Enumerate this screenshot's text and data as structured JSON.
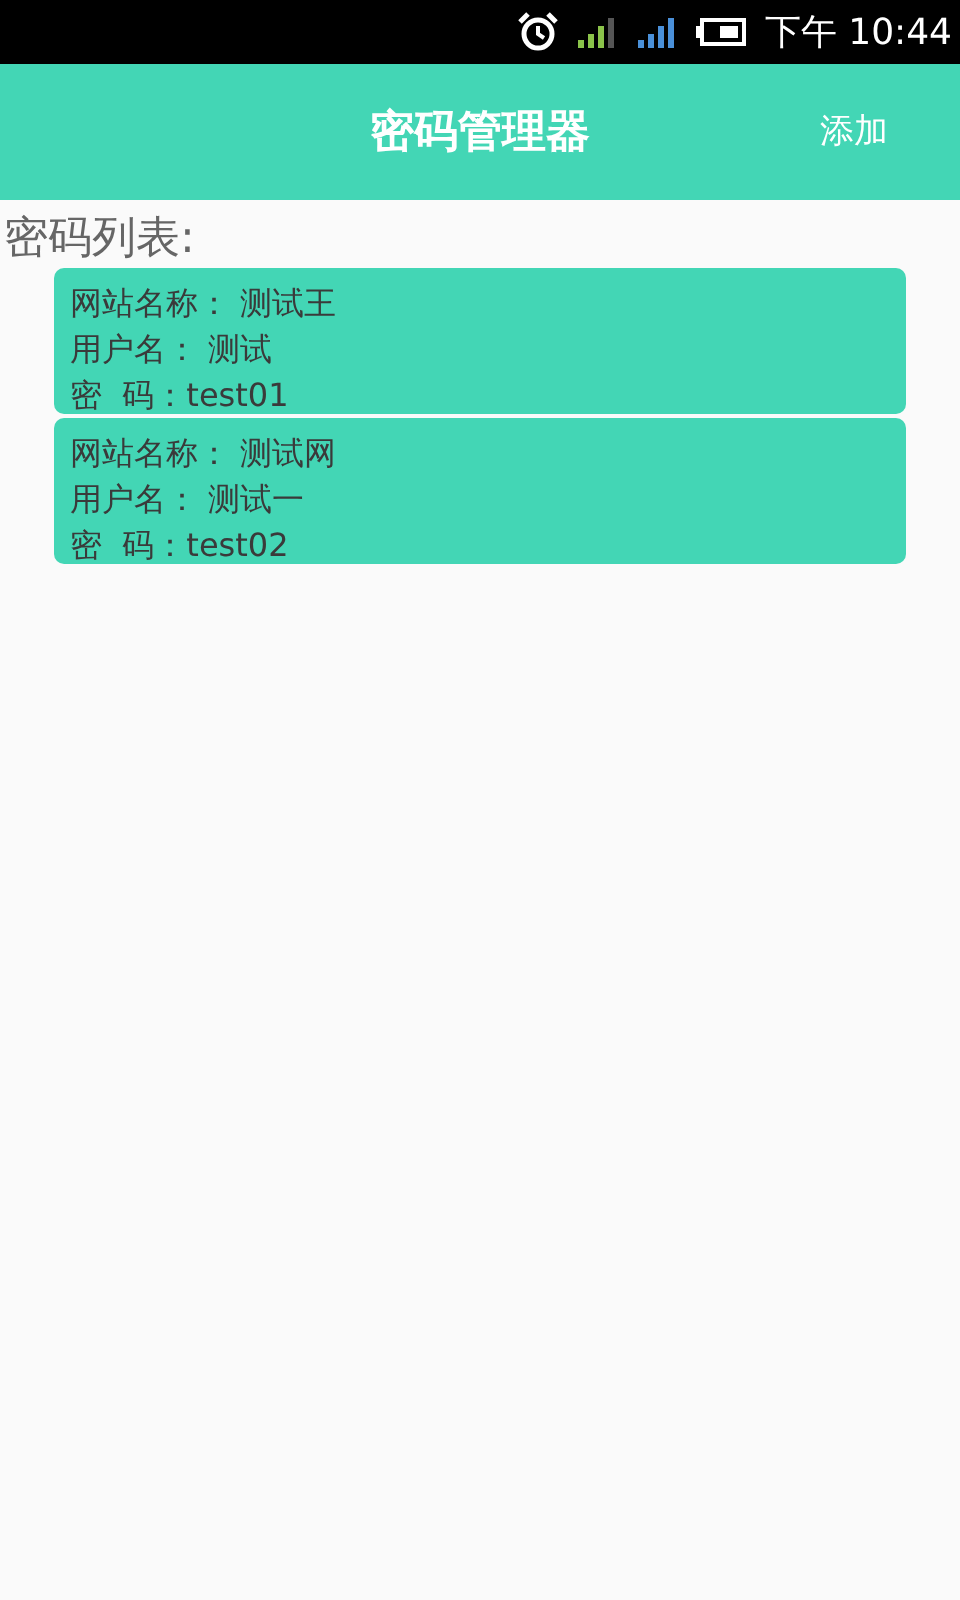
{
  "status_bar": {
    "time": "下午 10:44"
  },
  "header": {
    "title": "密码管理器",
    "add_button": "添加"
  },
  "list_title": "密码列表:",
  "entries": [
    {
      "site": "网站名称： 测试王",
      "user": "用户名： 测试",
      "password": "密  码：test01"
    },
    {
      "site": "网站名称： 测试网",
      "user": "用户名： 测试一",
      "password": "密  码：test02"
    }
  ]
}
